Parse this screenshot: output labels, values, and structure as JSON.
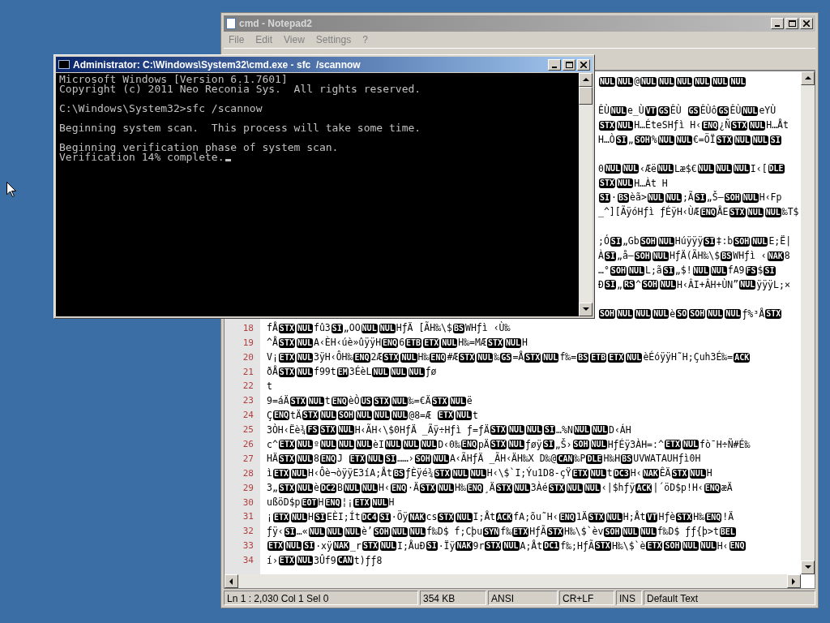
{
  "notepad": {
    "title": "cmd - Notepad2",
    "menu": [
      "File",
      "Edit",
      "View",
      "Settings",
      "?"
    ],
    "lines": [
      {
        "kind": "hidden",
        "runs": [
          {
            "code": "NUL"
          },
          {
            "code": "NUL"
          },
          {
            "text": "@"
          },
          {
            "code": "NUL"
          },
          {
            "code": "NUL"
          },
          {
            "code": "NUL"
          },
          {
            "code": "NUL"
          },
          {
            "code": "NUL"
          },
          {
            "code": "NUL"
          }
        ]
      },
      {
        "kind": "blank"
      },
      {
        "kind": "hidden",
        "runs": [
          {
            "text": "ÊÙ"
          },
          {
            "code": "NUL"
          },
          {
            "text": "e_Ù"
          },
          {
            "code": "VT"
          },
          {
            "code": "GS"
          },
          {
            "text": "ÊÙ "
          },
          {
            "code": "GS"
          },
          {
            "text": "ÊÙô"
          },
          {
            "code": "GS"
          },
          {
            "text": "ÊÙ"
          },
          {
            "code": "NUL"
          },
          {
            "text": "eYÙ"
          }
        ]
      },
      {
        "kind": "hidden",
        "runs": [
          {
            "code": "STX"
          },
          {
            "code": "NUL"
          },
          {
            "text": "H…ÉteSHƒì H‹"
          },
          {
            "code": "ENQ"
          },
          {
            "text": "¿Ñ"
          },
          {
            "code": "STX"
          },
          {
            "code": "NUL"
          },
          {
            "text": "H…Åt"
          }
        ]
      },
      {
        "kind": "hidden",
        "runs": [
          {
            "text": "H…Ò"
          },
          {
            "code": "SI"
          },
          {
            "text": "„"
          },
          {
            "code": "SOH"
          },
          {
            "text": "%"
          },
          {
            "code": "NUL"
          },
          {
            "code": "NUL"
          },
          {
            "text": "€=ÖÏ"
          },
          {
            "code": "STX"
          },
          {
            "code": "NUL"
          },
          {
            "code": "NUL"
          },
          {
            "code": "SI"
          }
        ]
      },
      {
        "kind": "blank"
      },
      {
        "kind": "hidden",
        "runs": [
          {
            "text": "0"
          },
          {
            "code": "NUL"
          },
          {
            "code": "NUL"
          },
          {
            "text": "‹Æë"
          },
          {
            "code": "NUL"
          },
          {
            "text": "Læ$€"
          },
          {
            "code": "NUL"
          },
          {
            "code": "NUL"
          },
          {
            "code": "NUL"
          },
          {
            "text": "I‹["
          },
          {
            "code": "DLE"
          }
        ]
      },
      {
        "kind": "hidden",
        "runs": [
          {
            "code": "STX"
          },
          {
            "code": "NUL"
          },
          {
            "text": "H…Àt H"
          }
        ]
      },
      {
        "kind": "hidden",
        "runs": [
          {
            "code": "SI"
          },
          {
            "text": "·"
          },
          {
            "code": "BS"
          },
          {
            "text": "èã>"
          },
          {
            "code": "NUL"
          },
          {
            "code": "NUL"
          },
          {
            "text": ";Ã"
          },
          {
            "code": "SI"
          },
          {
            "text": "„Š–"
          },
          {
            "code": "SOH"
          },
          {
            "code": "NUL"
          },
          {
            "text": "H‹Fp"
          }
        ]
      },
      {
        "kind": "hidden",
        "runs": [
          {
            "text": "_^][ÃÿóHƒì ƒÉÿH‹ÙÆ"
          },
          {
            "code": "ENQ"
          },
          {
            "text": "ÅE"
          },
          {
            "code": "STX"
          },
          {
            "code": "NUL"
          },
          {
            "code": "NUL"
          },
          {
            "text": "‰T$"
          }
        ]
      },
      {
        "kind": "blank"
      },
      {
        "kind": "hidden",
        "runs": [
          {
            "text": ";Ó"
          },
          {
            "code": "SI"
          },
          {
            "text": "„Gb"
          },
          {
            "code": "SOH"
          },
          {
            "code": "NUL"
          },
          {
            "text": "Húÿÿÿ"
          },
          {
            "code": "SI"
          },
          {
            "text": "‡:b"
          },
          {
            "code": "SOH"
          },
          {
            "code": "NUL"
          },
          {
            "text": "E;Ë|"
          }
        ]
      },
      {
        "kind": "hidden",
        "runs": [
          {
            "text": "À"
          },
          {
            "code": "SI"
          },
          {
            "text": "„å–"
          },
          {
            "code": "SOH"
          },
          {
            "code": "NUL"
          },
          {
            "text": "HƒÄ(ÃH‰\\$"
          },
          {
            "code": "BS"
          },
          {
            "text": "WHƒì ‹"
          },
          {
            "code": "NAK"
          },
          {
            "text": "8"
          }
        ]
      },
      {
        "kind": "hidden",
        "runs": [
          {
            "text": "…°"
          },
          {
            "code": "SOH"
          },
          {
            "code": "NUL"
          },
          {
            "text": "L;ã"
          },
          {
            "code": "SI"
          },
          {
            "text": "„$!"
          },
          {
            "code": "NUL"
          },
          {
            "code": "NUL"
          },
          {
            "text": "fA9"
          },
          {
            "code": "FS"
          },
          {
            "text": "$"
          },
          {
            "code": "SI"
          }
        ]
      },
      {
        "kind": "hidden",
        "runs": [
          {
            "text": "Ð"
          },
          {
            "code": "SI"
          },
          {
            "text": "„"
          },
          {
            "code": "RS"
          },
          {
            "text": "^"
          },
          {
            "code": "SOH"
          },
          {
            "code": "NUL"
          },
          {
            "text": "H‹ÂI+ÂH+ÙN”"
          },
          {
            "code": "NUL"
          },
          {
            "text": "ÿÿÿL;×"
          }
        ]
      },
      {
        "kind": "blank"
      },
      {
        "kind": "hidden",
        "runs": [
          {
            "code": "SOH"
          },
          {
            "code": "NUL"
          },
          {
            "code": "NUL"
          },
          {
            "code": "NUL"
          },
          {
            "text": "è"
          },
          {
            "code": "SO"
          },
          {
            "code": "SOH"
          },
          {
            "code": "NUL"
          },
          {
            "code": "NUL"
          },
          {
            "text": "ƒ%³Å"
          },
          {
            "code": "STX"
          }
        ]
      },
      {
        "kind": "shown",
        "number": "18",
        "runs": [
          {
            "text": "fÅ"
          },
          {
            "code": "STX"
          },
          {
            "code": "NUL"
          },
          {
            "text": "fû3"
          },
          {
            "code": "SI"
          },
          {
            "text": "„OO"
          },
          {
            "code": "NUL"
          },
          {
            "code": "NUL"
          },
          {
            "text": "HƒÄ [ÃH‰\\$"
          },
          {
            "code": "BS"
          },
          {
            "text": "WHƒì ‹Ù‰"
          }
        ]
      },
      {
        "kind": "shown",
        "number": "19",
        "runs": [
          {
            "text": "^Å"
          },
          {
            "code": "STX"
          },
          {
            "code": "NUL"
          },
          {
            "text": "A‹ÈH‹úè»ûÿÿH"
          },
          {
            "code": "ENQ"
          },
          {
            "text": "6"
          },
          {
            "code": "ETB"
          },
          {
            "code": "ETX"
          },
          {
            "code": "NUL"
          },
          {
            "text": "H‰=MÆ"
          },
          {
            "code": "STX"
          },
          {
            "code": "NUL"
          },
          {
            "text": "H"
          }
        ]
      },
      {
        "kind": "shown",
        "number": "20",
        "runs": [
          {
            "text": "V¡"
          },
          {
            "code": "ETX"
          },
          {
            "code": "NUL"
          },
          {
            "text": "3ÿH‹ÔH‰"
          },
          {
            "code": "ENQ"
          },
          {
            "text": "2Æ"
          },
          {
            "code": "STX"
          },
          {
            "code": "NUL"
          },
          {
            "text": "H‰"
          },
          {
            "code": "ENQ"
          },
          {
            "text": "#Æ"
          },
          {
            "code": "STX"
          },
          {
            "code": "NUL"
          },
          {
            "text": "‰"
          },
          {
            "code": "GS"
          },
          {
            "text": "=Å"
          },
          {
            "code": "STX"
          },
          {
            "code": "NUL"
          },
          {
            "text": "f‰="
          },
          {
            "code": "BS"
          },
          {
            "code": "ETB"
          },
          {
            "code": "ETX"
          },
          {
            "code": "NUL"
          },
          {
            "text": "èÉóÿÿH˜H;Çuh3É‰="
          },
          {
            "code": "ACK"
          }
        ]
      },
      {
        "kind": "shown",
        "number": "21",
        "runs": [
          {
            "text": "ðÅ"
          },
          {
            "code": "STX"
          },
          {
            "code": "NUL"
          },
          {
            "text": "f99t"
          },
          {
            "code": "EM"
          },
          {
            "text": "3ÉèL"
          },
          {
            "code": "NUL"
          },
          {
            "code": "NUL"
          },
          {
            "code": "NUL"
          },
          {
            "text": "ƒø"
          }
        ]
      },
      {
        "kind": "shown",
        "number": "22",
        "runs": [
          {
            "text": "t"
          }
        ]
      },
      {
        "kind": "shown",
        "number": "23",
        "runs": [
          {
            "text": "9=áÄ"
          },
          {
            "code": "STX"
          },
          {
            "code": "NUL"
          },
          {
            "text": "t"
          },
          {
            "code": "ENQ"
          },
          {
            "text": "èÒ"
          },
          {
            "code": "US"
          },
          {
            "code": "STX"
          },
          {
            "code": "NUL"
          },
          {
            "text": "‰=€Ä"
          },
          {
            "code": "STX"
          },
          {
            "code": "NUL"
          },
          {
            "text": "ë"
          }
        ]
      },
      {
        "kind": "shown",
        "number": "24",
        "runs": [
          {
            "text": "Ç"
          },
          {
            "code": "ENQ"
          },
          {
            "text": "tÄ"
          },
          {
            "code": "STX"
          },
          {
            "code": "NUL"
          },
          {
            "code": "SOH"
          },
          {
            "code": "NUL"
          },
          {
            "code": "NUL"
          },
          {
            "code": "NUL"
          },
          {
            "text": "@8=Æ "
          },
          {
            "code": "ETX"
          },
          {
            "code": "NUL"
          },
          {
            "text": "t"
          }
        ]
      },
      {
        "kind": "shown",
        "number": "25",
        "runs": [
          {
            "text": "3ÒH‹Ëè¾"
          },
          {
            "code": "FS"
          },
          {
            "code": "STX"
          },
          {
            "code": "NUL"
          },
          {
            "text": "H‹ÃH‹\\$0HƒÄ _Ãÿ÷Hƒì ƒ=ƒÄ"
          },
          {
            "code": "STX"
          },
          {
            "code": "NUL"
          },
          {
            "code": "NUL"
          },
          {
            "code": "SI"
          },
          {
            "text": "…%N"
          },
          {
            "code": "NUL"
          },
          {
            "code": "NUL"
          },
          {
            "text": "D‹ÁH"
          }
        ]
      },
      {
        "kind": "shown",
        "number": "26",
        "runs": [
          {
            "text": "c^"
          },
          {
            "code": "ETX"
          },
          {
            "code": "NUL"
          },
          {
            "text": "º"
          },
          {
            "code": "NUL"
          },
          {
            "code": "NUL"
          },
          {
            "code": "NUL"
          },
          {
            "text": "èI"
          },
          {
            "code": "NUL"
          },
          {
            "code": "NUL"
          },
          {
            "code": "NUL"
          },
          {
            "text": "D‹0‰"
          },
          {
            "code": "ENQ"
          },
          {
            "text": "pÄ"
          },
          {
            "code": "STX"
          },
          {
            "code": "NUL"
          },
          {
            "text": "ƒøÿ"
          },
          {
            "code": "SI"
          },
          {
            "text": "„Š›"
          },
          {
            "code": "SOH"
          },
          {
            "code": "NUL"
          },
          {
            "text": "HƒÉÿ3ÀH=:^"
          },
          {
            "code": "ETX"
          },
          {
            "code": "NUL"
          },
          {
            "text": "fò¯H÷Ñ#É‰"
          }
        ]
      },
      {
        "kind": "shown",
        "number": "27",
        "runs": [
          {
            "text": "HÄ"
          },
          {
            "code": "STX"
          },
          {
            "code": "NUL"
          },
          {
            "text": "8"
          },
          {
            "code": "ENQ"
          },
          {
            "text": "J "
          },
          {
            "code": "ETX"
          },
          {
            "code": "NUL"
          },
          {
            "code": "SI"
          },
          {
            "text": "……›"
          },
          {
            "code": "SOH"
          },
          {
            "code": "NUL"
          },
          {
            "text": "A‹ÃHƒÄ _ÃH‹ÄH‰X D‰@"
          },
          {
            "code": "CAN"
          },
          {
            "text": "‰P"
          },
          {
            "code": "DLE"
          },
          {
            "text": "H‰H"
          },
          {
            "code": "BS"
          },
          {
            "text": "UVWATAUHƒì0H"
          }
        ]
      },
      {
        "kind": "shown",
        "number": "28",
        "runs": [
          {
            "text": "ì"
          },
          {
            "code": "ETX"
          },
          {
            "code": "NUL"
          },
          {
            "text": "H‹Ôè¬òÿÿE3íA;Åt"
          },
          {
            "code": "BS"
          },
          {
            "text": "ƒÈÿé¾"
          },
          {
            "code": "STX"
          },
          {
            "code": "NUL"
          },
          {
            "code": "NUL"
          },
          {
            "text": "H‹\\$`I;Ýu1D8-çŸ"
          },
          {
            "code": "ETX"
          },
          {
            "code": "NUL"
          },
          {
            "text": "t"
          },
          {
            "code": "DC3"
          },
          {
            "text": "H‹"
          },
          {
            "code": "NAK"
          },
          {
            "text": "ÊÄ"
          },
          {
            "code": "STX"
          },
          {
            "code": "NUL"
          },
          {
            "text": "H"
          }
        ]
      },
      {
        "kind": "shown",
        "number": "29",
        "runs": [
          {
            "text": "3„"
          },
          {
            "code": "STX"
          },
          {
            "code": "NUL"
          },
          {
            "text": "è"
          },
          {
            "code": "DC2"
          },
          {
            "text": "B"
          },
          {
            "code": "NUL"
          },
          {
            "code": "NUL"
          },
          {
            "text": "H‹"
          },
          {
            "code": "ENQ"
          },
          {
            "text": "·Ä"
          },
          {
            "code": "STX"
          },
          {
            "code": "NUL"
          },
          {
            "text": "H‰"
          },
          {
            "code": "ENQ"
          },
          {
            "text": "¸Ä"
          },
          {
            "code": "STX"
          },
          {
            "code": "NUL"
          },
          {
            "text": "3Àé"
          },
          {
            "code": "STX"
          },
          {
            "code": "NUL"
          },
          {
            "code": "NUL"
          },
          {
            "text": "‹|$hƒÿ"
          },
          {
            "code": "ACK"
          },
          {
            "text": "|´öD$p!H‹"
          },
          {
            "code": "ENQ"
          },
          {
            "text": "æÄ"
          }
        ]
      },
      {
        "kind": "shown",
        "number": "30",
        "runs": [
          {
            "text": "ußöD$p"
          },
          {
            "code": "EOT"
          },
          {
            "text": "H"
          },
          {
            "code": "ENQ"
          },
          {
            "text": "¦¡"
          },
          {
            "code": "ETX"
          },
          {
            "code": "NUL"
          },
          {
            "text": "H"
          }
        ]
      },
      {
        "kind": "shown",
        "number": "31",
        "runs": [
          {
            "text": "¡"
          },
          {
            "code": "ETX"
          },
          {
            "code": "NUL"
          },
          {
            "text": "H"
          },
          {
            "code": "SI"
          },
          {
            "text": "EÈI;Ít"
          },
          {
            "code": "DC4"
          },
          {
            "code": "SI"
          },
          {
            "text": "·Öÿ"
          },
          {
            "code": "NAK"
          },
          {
            "text": "cs"
          },
          {
            "code": "STX"
          },
          {
            "code": "NUL"
          },
          {
            "text": "I;Åt"
          },
          {
            "code": "ACK"
          },
          {
            "text": "fA;õu˜H‹"
          },
          {
            "code": "ENQ"
          },
          {
            "text": "1Ä"
          },
          {
            "code": "STX"
          },
          {
            "code": "NUL"
          },
          {
            "text": "H;Åt"
          },
          {
            "code": "VT"
          },
          {
            "text": "Hƒè"
          },
          {
            "code": "STX"
          },
          {
            "text": "H‰"
          },
          {
            "code": "ENQ"
          },
          {
            "text": "!Ä"
          }
        ]
      },
      {
        "kind": "shown",
        "number": "32",
        "runs": [
          {
            "text": "ƒÿ‹"
          },
          {
            "code": "SI"
          },
          {
            "text": "…«"
          },
          {
            "code": "NUL"
          },
          {
            "code": "NUL"
          },
          {
            "code": "NUL"
          },
          {
            "text": "è’"
          },
          {
            "code": "SOH"
          },
          {
            "code": "NUL"
          },
          {
            "code": "NUL"
          },
          {
            "text": "f‰D$ f;Cþu"
          },
          {
            "code": "SYN"
          },
          {
            "text": "f‰"
          },
          {
            "code": "ETX"
          },
          {
            "text": "HƒÃ"
          },
          {
            "code": "STX"
          },
          {
            "text": "H‰\\$`èv"
          },
          {
            "code": "SOH"
          },
          {
            "code": "NUL"
          },
          {
            "code": "NUL"
          },
          {
            "text": "f‰D$ ƒƒ{þ>t"
          },
          {
            "code": "BEL"
          }
        ]
      },
      {
        "kind": "shown",
        "number": "33",
        "runs": [
          {
            "code": "ETX"
          },
          {
            "code": "NUL"
          },
          {
            "code": "SI"
          },
          {
            "text": "·xÿ"
          },
          {
            "code": "NAK"
          },
          {
            "text": "_r"
          },
          {
            "code": "STX"
          },
          {
            "code": "NUL"
          },
          {
            "text": "I;ÅuÐ"
          },
          {
            "code": "SI"
          },
          {
            "text": "·Ïÿ"
          },
          {
            "code": "NAK"
          },
          {
            "text": "9r"
          },
          {
            "code": "STX"
          },
          {
            "code": "NUL"
          },
          {
            "text": "A;Åt"
          },
          {
            "code": "DC1"
          },
          {
            "text": "f‰;HƒÃ"
          },
          {
            "code": "STX"
          },
          {
            "text": "H‰\\$`è"
          },
          {
            "code": "ETX"
          },
          {
            "code": "SOH"
          },
          {
            "code": "NUL"
          },
          {
            "code": "NUL"
          },
          {
            "text": "H‹"
          },
          {
            "code": "ENQ"
          }
        ]
      },
      {
        "kind": "shown",
        "number": "34",
        "runs": [
          {
            "text": "í›"
          },
          {
            "code": "ETX"
          },
          {
            "code": "NUL"
          },
          {
            "text": "3Ûf9"
          },
          {
            "code": "CAN"
          },
          {
            "text": "t)ƒƒ8"
          }
        ]
      }
    ],
    "status": [
      "Ln 1 : 2,030   Col 1   Sel 0",
      "354 KB",
      "ANSI",
      "CR+LF",
      "INS",
      "Default Text"
    ]
  },
  "console": {
    "title": "Administrator: C:\\Windows\\System32\\cmd.exe - sfc  /scannow",
    "cursor": true,
    "paragraphs": [
      [
        "Microsoft Windows [Version 6.1.7601]",
        "Copyright (c) 2011 Neo Reconia Sys.  All rights reserved."
      ],
      [
        "C:\\Windows\\System32>sfc /scannow"
      ],
      [
        "Beginning system scan.  This process will take some time."
      ],
      [
        "Beginning verification phase of system scan.",
        "Verification 14% complete."
      ]
    ]
  }
}
